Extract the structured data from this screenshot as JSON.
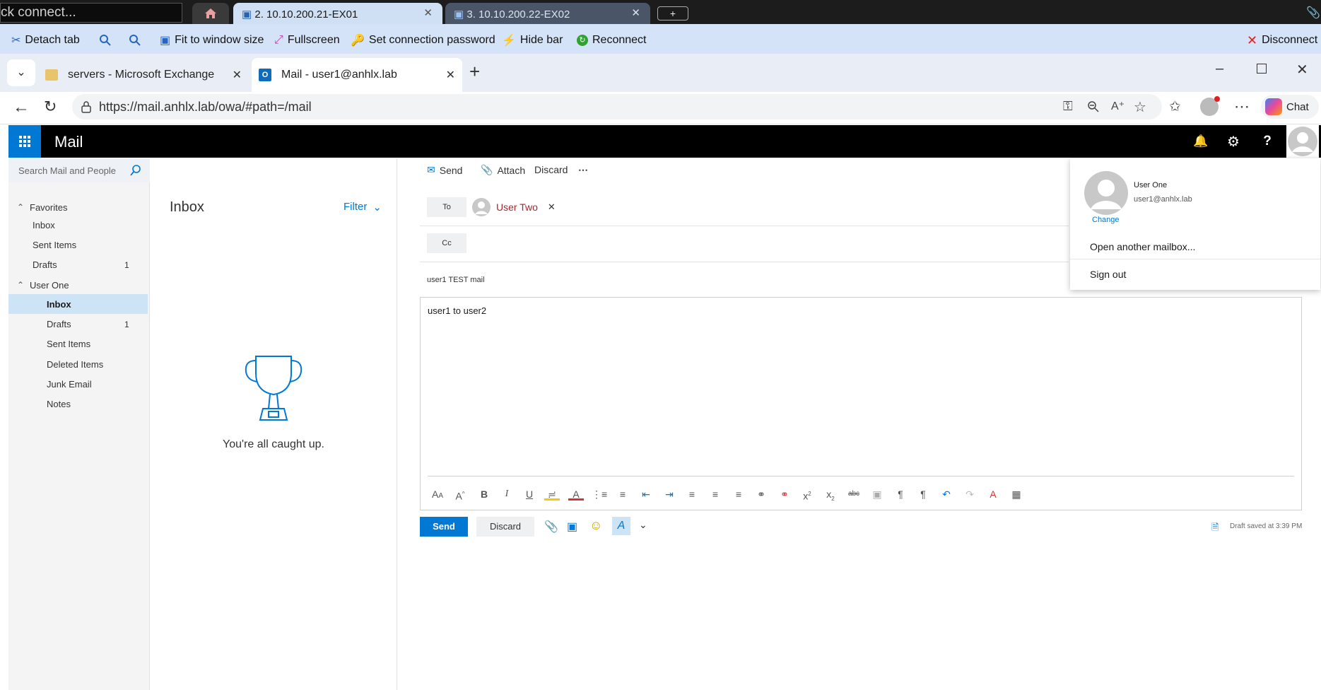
{
  "remote_bar": {
    "quick_connect": "ck connect...",
    "tab1_label": "2. 10.10.200.21-EX01",
    "tab2_label": "3. 10.10.200.22-EX02",
    "add_tab": "+"
  },
  "connection_toolbar": {
    "detach": "Detach tab",
    "fit": "Fit to window size",
    "fullscreen": "Fullscreen",
    "set_password": "Set connection password",
    "hide_bar": "Hide bar",
    "reconnect": "Reconnect",
    "disconnect": "Disconnect"
  },
  "browser": {
    "tabs": [
      {
        "label": "servers - Microsoft Exchange"
      },
      {
        "label": "Mail - user1@anhlx.lab"
      }
    ],
    "url": "https://mail.anhlx.lab/owa/#path=/mail",
    "chat_label": "Chat"
  },
  "owa": {
    "app_title": "Mail",
    "search_placeholder": "Search Mail and People",
    "folders": {
      "favorites_header": "Favorites",
      "favorites": [
        {
          "label": "Inbox",
          "count": ""
        },
        {
          "label": "Sent Items",
          "count": ""
        },
        {
          "label": "Drafts",
          "count": "1"
        }
      ],
      "account_header": "User One",
      "account_folders": [
        {
          "label": "Inbox",
          "count": ""
        },
        {
          "label": "Drafts",
          "count": "1"
        },
        {
          "label": "Sent Items",
          "count": ""
        },
        {
          "label": "Deleted Items",
          "count": ""
        },
        {
          "label": "Junk Email",
          "count": ""
        },
        {
          "label": "Notes",
          "count": ""
        }
      ]
    },
    "list": {
      "title": "Inbox",
      "filter": "Filter",
      "empty_message": "You're all caught up."
    },
    "compose": {
      "toolbar": {
        "send": "Send",
        "attach": "Attach",
        "discard": "Discard"
      },
      "to_label": "To",
      "recipient": "User Two",
      "cc_label": "Cc",
      "subject": "user1 TEST mail",
      "body": "user1 to user2",
      "send_button": "Send",
      "discard_button": "Discard",
      "draft_status": "Draft saved at 3:39 PM"
    },
    "account_menu": {
      "name": "User One",
      "email": "user1@anhlx.lab",
      "change": "Change",
      "open_another": "Open another mailbox...",
      "sign_out": "Sign out"
    }
  },
  "colors": {
    "owa_blue": "#0078d4",
    "recipient_red": "#a4262c",
    "header_black": "#000000"
  }
}
